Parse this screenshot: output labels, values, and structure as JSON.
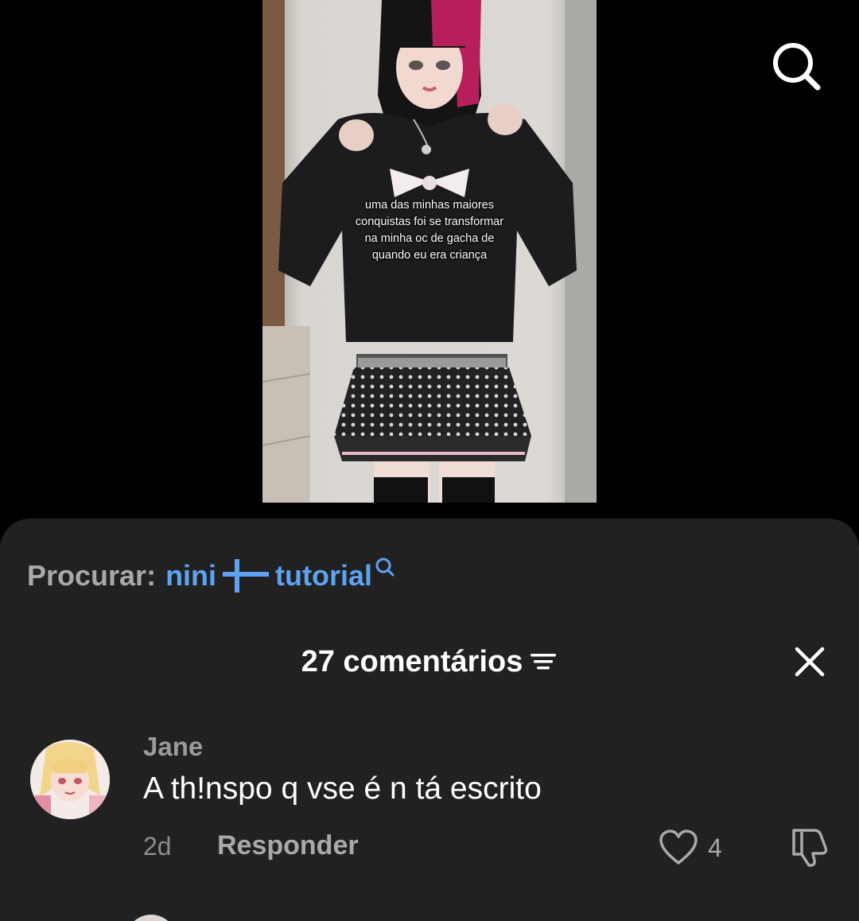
{
  "video": {
    "caption_lines": [
      "uma das minhas maiores",
      "conquistas foi se transformar",
      "na minha oc de gacha de",
      "quando eu era criança"
    ]
  },
  "top_bar": {
    "search_icon": "search-icon"
  },
  "comments_sheet": {
    "search_suggestion": {
      "prefix": "Procurar:",
      "query_part1": "nini",
      "query_separator_icon": "plus-cross-icon",
      "query_part2": "tutorial",
      "trailing_icon": "search-icon"
    },
    "title": "27 comentários",
    "sort_icon": "sort-lines-icon",
    "close_icon": "close-icon",
    "comments": [
      {
        "username": "Jane",
        "text": "A th!nspo q vse é n tá escrito",
        "age": "2d",
        "reply_label": "Responder",
        "like_count": "4",
        "like_icon": "heart-icon",
        "dislike_icon": "thumbs-down-icon"
      }
    ]
  },
  "colors": {
    "background": "#000000",
    "sheet": "#212121",
    "accent_blue": "#5ea3f2",
    "text_primary": "#ffffff",
    "text_secondary": "#a9a9a9"
  }
}
